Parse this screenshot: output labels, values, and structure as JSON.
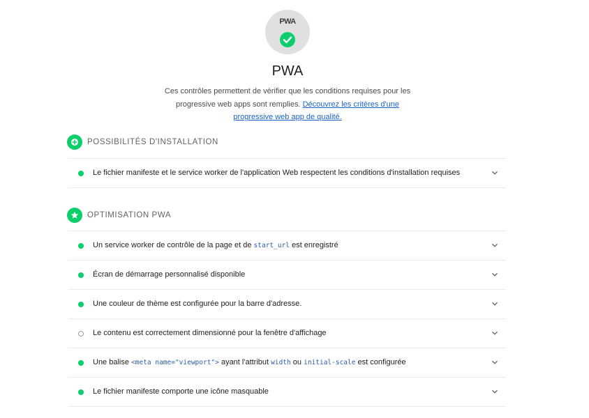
{
  "header": {
    "badge_text": "PWA",
    "title": "PWA",
    "description_text": "Ces contrôles permettent de vérifier que les conditions requises pour les progressive web apps sont remplies. ",
    "description_link": "Découvrez les critères d'une progressive web app de qualité."
  },
  "colors": {
    "pass": "#0cce6b",
    "link": "#1a63c6",
    "code": "#2b5cad"
  },
  "installable": {
    "title": "POSSIBILITÉS D'INSTALLATION",
    "icon": "plus-circle-icon",
    "audits": [
      {
        "status": "pass",
        "text": "Le fichier manifeste et le service worker de l'application Web respectent les conditions d'installation requises"
      }
    ]
  },
  "optimized": {
    "title": "OPTIMISATION PWA",
    "icon": "star-icon",
    "audits": [
      {
        "status": "pass",
        "text_before": "Un service worker de contrôle de la page et de ",
        "code": "start_url",
        "text_after": " est enregistré"
      },
      {
        "status": "pass",
        "text": "Écran de démarrage personnalisé disponible"
      },
      {
        "status": "pass",
        "text": "Une couleur de thème est configurée pour la barre d'adresse."
      },
      {
        "status": "notApplicable",
        "text": "Le contenu est correctement dimensionné pour la fenêtre d'affichage"
      },
      {
        "status": "pass",
        "text_1": "Une balise ",
        "code_1": "<meta name=\"viewport\">",
        "text_2": " ayant l'attribut ",
        "code_2": "width",
        "text_3": " ou ",
        "code_3": "initial-scale",
        "text_4": " est configurée"
      },
      {
        "status": "pass",
        "text": "Le fichier manifeste comporte une icône masquable"
      }
    ]
  }
}
